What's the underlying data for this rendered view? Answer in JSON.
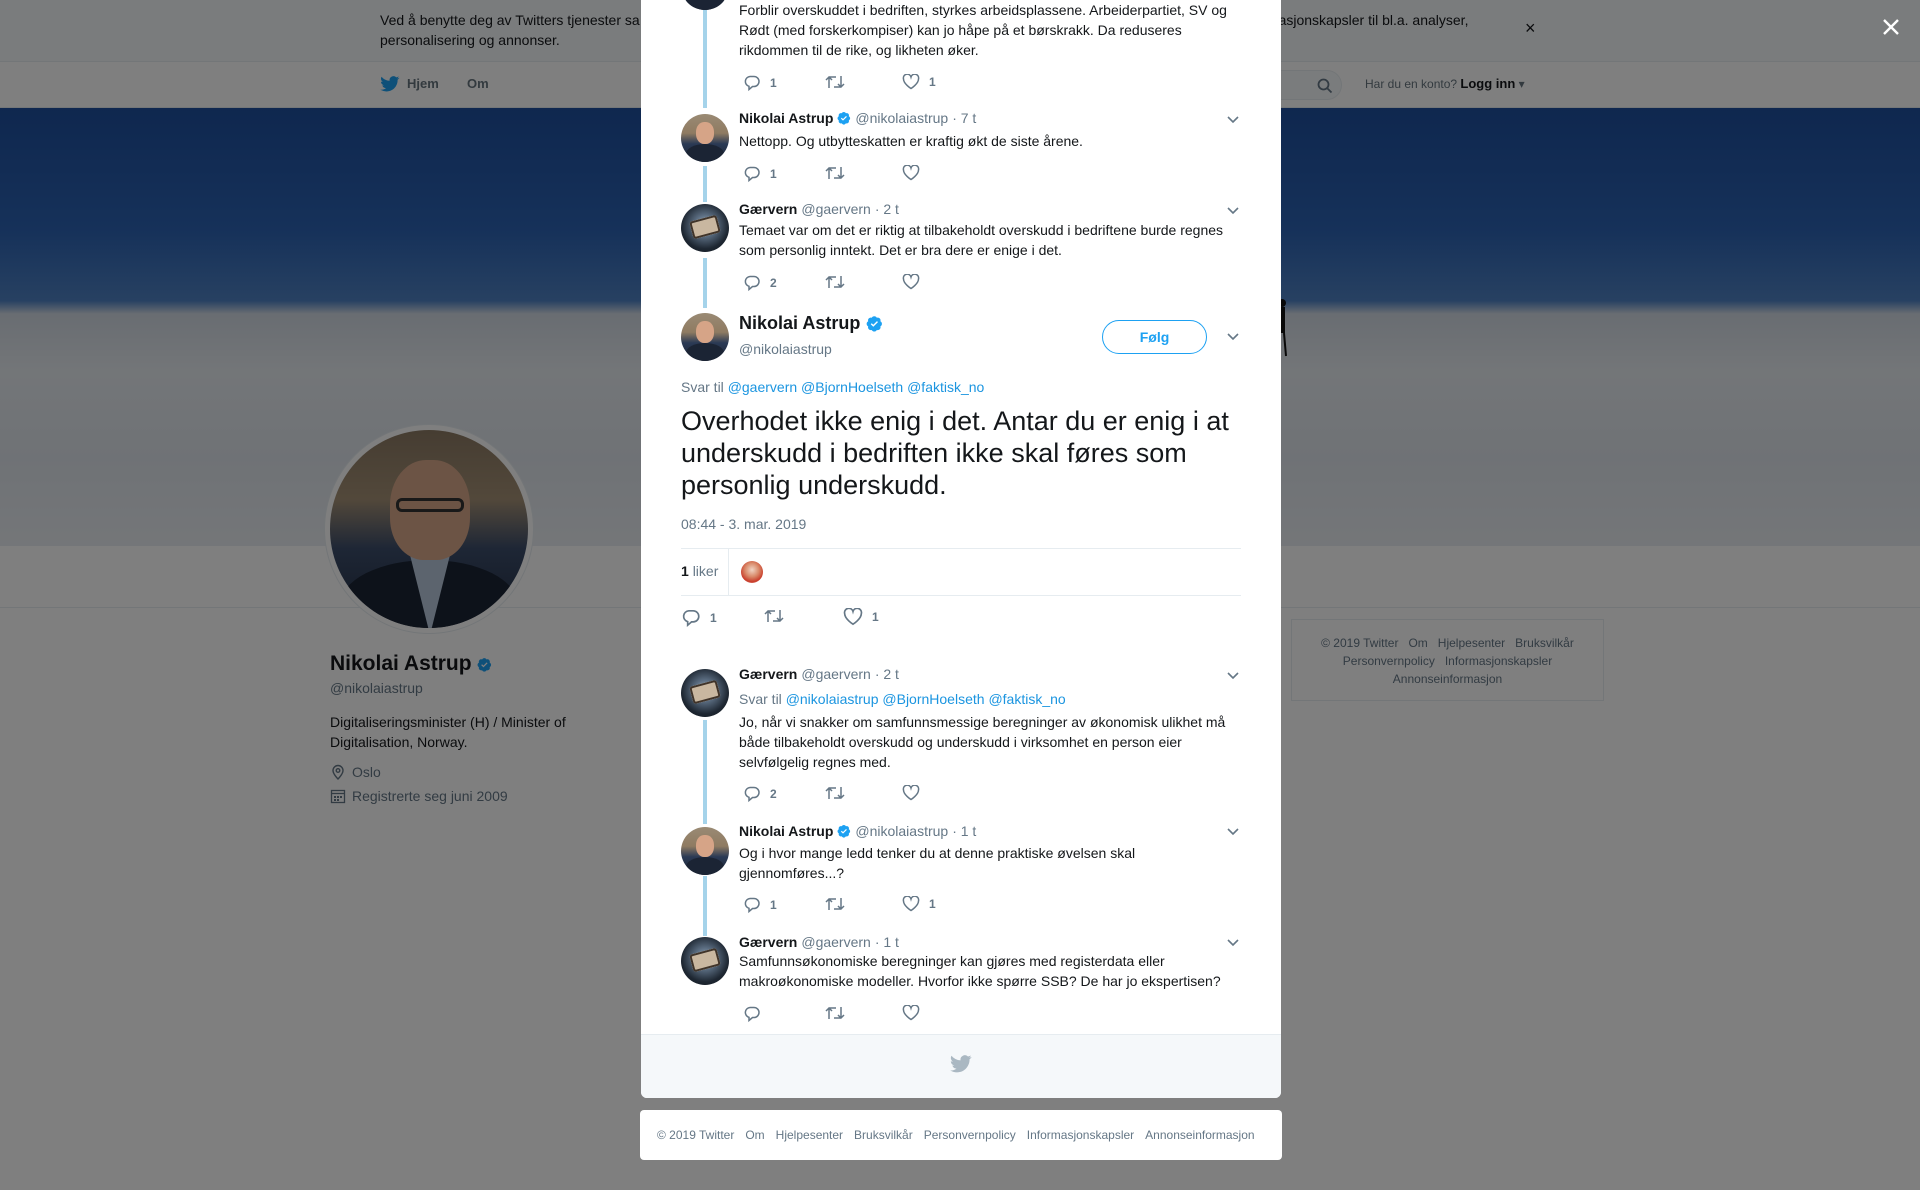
{
  "cookie_bar": {
    "text": "Ved å benytte deg av Twitters tjenester sa",
    "text_end": "informasjonskapsler til bl.a. analyser, personalisering og annonser."
  },
  "top_nav": {
    "home": "Hjem",
    "about": "Om",
    "has_account": "Har du en konto?",
    "login": "Logg inn"
  },
  "profile": {
    "name": "Nikolai Astrup",
    "handle": "@nikolaiastrup",
    "bio": "Digitaliseringsminister (H) / Minister of Digitalisation, Norway.",
    "location": "Oslo",
    "joined": "Registrerte seg juni 2009"
  },
  "side_footer": {
    "links": [
      "© 2019 Twitter",
      "Om",
      "Hjelpesenter",
      "Bruksvilkår",
      "Personvernpolicy",
      "Informasjonskapsler",
      "Annonseinformasjon"
    ]
  },
  "tweets": {
    "t0": {
      "text": "Forblir overskuddet i bedriften, styrkes arbeidsplassene. Arbeiderpartiet, SV og Rødt (med forskerkompiser) kan jo håpe på et børskrakk. Da reduseres rikdommen til de rike, og likheten øker.",
      "replies": "1",
      "likes": "1"
    },
    "t1": {
      "name": "Nikolai Astrup",
      "handle": "@nikolaiastrup",
      "time": "· 7 t",
      "text": "Nettopp. Og utbytteskatten er kraftig økt de siste årene.",
      "replies": "1"
    },
    "t2": {
      "name": "Gærvern",
      "handle": "@gaervern",
      "time": "· 2 t",
      "text": "Temaet var om det er riktig at tilbakeholdt overskudd i bedriftene burde regnes som personlig inntekt. Det er bra dere er enige i det.",
      "replies": "2"
    },
    "focus": {
      "name": "Nikolai Astrup",
      "handle": "@nikolaiastrup",
      "follow": "Følg",
      "reply_prefix": "Svar til",
      "reply_to": [
        "@gaervern",
        "@BjornHoelseth",
        "@faktisk_no"
      ],
      "text": "Overhodet ikke enig i det. Antar du er enig i at underskudd i bedriften ikke skal føres som personlig underskudd.",
      "timestamp": "08:44 - 3. mar. 2019",
      "like_count": "1",
      "like_label": "liker",
      "replies": "1",
      "likes": "1"
    },
    "t3": {
      "name": "Gærvern",
      "handle": "@gaervern",
      "time": "· 2 t",
      "reply_prefix": "Svar til",
      "reply_to": [
        "@nikolaiastrup",
        "@BjornHoelseth",
        "@faktisk_no"
      ],
      "text": "Jo, når vi snakker om samfunnsmessige beregninger av økonomisk ulikhet må både tilbakeholdt overskudd og underskudd i virksomhet en person eier selvfølgelig regnes med.",
      "replies": "2"
    },
    "t4": {
      "name": "Nikolai Astrup",
      "handle": "@nikolaiastrup",
      "time": "· 1 t",
      "text": "Og i hvor mange ledd tenker du at denne praktiske øvelsen skal gjennomføres...?",
      "replies": "1",
      "likes": "1"
    },
    "t5": {
      "name": "Gærvern",
      "handle": "@gaervern",
      "time": "· 1 t",
      "text": "Samfunnsøkonomiske beregninger kan gjøres med registerdata eller makroøkonomiske modeller. Hvorfor ikke spørre SSB? De har jo ekspertisen?"
    }
  },
  "bottom_footer": {
    "links": [
      "© 2019 Twitter",
      "Om",
      "Hjelpesenter",
      "Bruksvilkår",
      "Personvernpolicy",
      "Informasjonskapsler",
      "Annonseinformasjon"
    ]
  },
  "icons": {
    "reply": "reply-icon",
    "retweet": "retweet-icon",
    "like": "heart-icon",
    "verified": "verified-badge-icon",
    "caret": "chevron-down-icon",
    "close": "close-icon",
    "bird": "twitter-bird-icon",
    "search": "search-icon"
  },
  "colors": {
    "accent": "#1da1f2",
    "link": "#1b95e0",
    "thread": "#a5d3ea",
    "muted": "#657786"
  }
}
